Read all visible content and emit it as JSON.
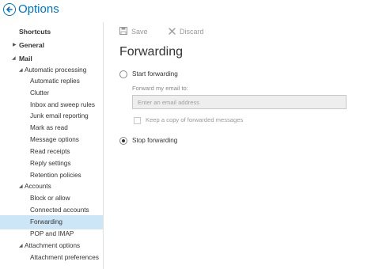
{
  "header": {
    "title": "Options"
  },
  "sidebar": {
    "items": [
      {
        "label": "Shortcuts"
      },
      {
        "label": "General"
      },
      {
        "label": "Mail"
      },
      {
        "label": "Automatic processing"
      },
      {
        "label": "Automatic replies"
      },
      {
        "label": "Clutter"
      },
      {
        "label": "Inbox and sweep rules"
      },
      {
        "label": "Junk email reporting"
      },
      {
        "label": "Mark as read"
      },
      {
        "label": "Message options"
      },
      {
        "label": "Read receipts"
      },
      {
        "label": "Reply settings"
      },
      {
        "label": "Retention policies"
      },
      {
        "label": "Accounts"
      },
      {
        "label": "Block or allow"
      },
      {
        "label": "Connected accounts"
      },
      {
        "label": "Forwarding"
      },
      {
        "label": "POP and IMAP"
      },
      {
        "label": "Attachment options"
      },
      {
        "label": "Attachment preferences"
      }
    ],
    "selected": "Forwarding"
  },
  "toolbar": {
    "save_label": "Save",
    "discard_label": "Discard"
  },
  "main": {
    "title": "Forwarding",
    "start_forwarding_label": "Start forwarding",
    "forward_field_label": "Forward my email to:",
    "email_placeholder": "Enter an email address",
    "keep_copy_label": "Keep a copy of forwarded messages",
    "stop_forwarding_label": "Stop forwarding",
    "forwarding_enabled": false
  },
  "colors": {
    "accent": "#0072c6",
    "selected_bg": "#cde6f7",
    "disabled_text": "#999999"
  }
}
